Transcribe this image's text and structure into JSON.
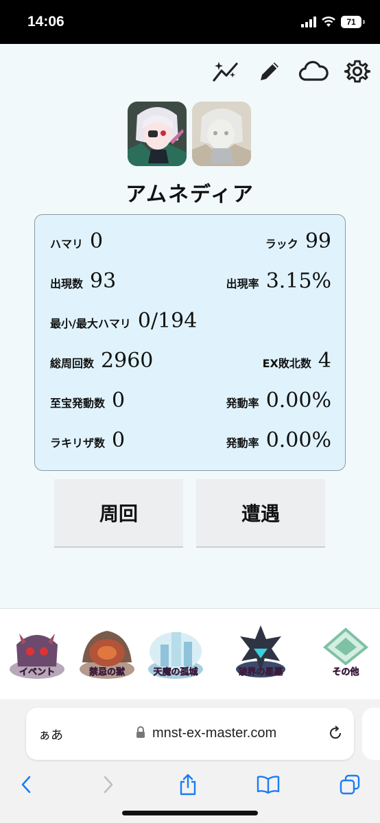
{
  "status_bar": {
    "time": "14:06",
    "battery": "71"
  },
  "toolbar": {
    "icons": [
      "sparkle-chart-icon",
      "pencil-icon",
      "cloud-icon",
      "gear-icon"
    ]
  },
  "character": {
    "name": "アムネディア"
  },
  "stats": {
    "hamari_label": "ハマリ",
    "hamari_value": "0",
    "luck_label": "ラック",
    "luck_value": "99",
    "appear_count_label": "出現数",
    "appear_count_value": "93",
    "appear_rate_label": "出現率",
    "appear_rate_value": "3.15%",
    "minmax_label": "最小/最大ハマリ",
    "minmax_value": "0/194",
    "total_laps_label": "総周回数",
    "total_laps_value": "2960",
    "ex_defeat_label": "EX敗北数",
    "ex_defeat_value": "4",
    "treasure_count_label": "至宝発動数",
    "treasure_count_value": "0",
    "treasure_rate_label": "発動率",
    "treasure_rate_value": "0.00%",
    "lakiriza_count_label": "ラキリザ数",
    "lakiriza_count_value": "0",
    "lakiriza_rate_label": "発動率",
    "lakiriza_rate_value": "0.00%"
  },
  "actions": {
    "lap_label": "周回",
    "encounter_label": "遭遇"
  },
  "categories": [
    {
      "label": "イベント",
      "color": "#6b4a6e"
    },
    {
      "label": "禁忌の獄",
      "color": "#b2533a"
    },
    {
      "label": "天魔の孤城",
      "color": "#8fc3d9"
    },
    {
      "label": "破界の星墓",
      "color": "#2f3442"
    },
    {
      "label": "その他",
      "color": "#7fc1a4"
    }
  ],
  "browser": {
    "aa_label": "ぁあ",
    "url": "mnst-ex-master.com"
  }
}
